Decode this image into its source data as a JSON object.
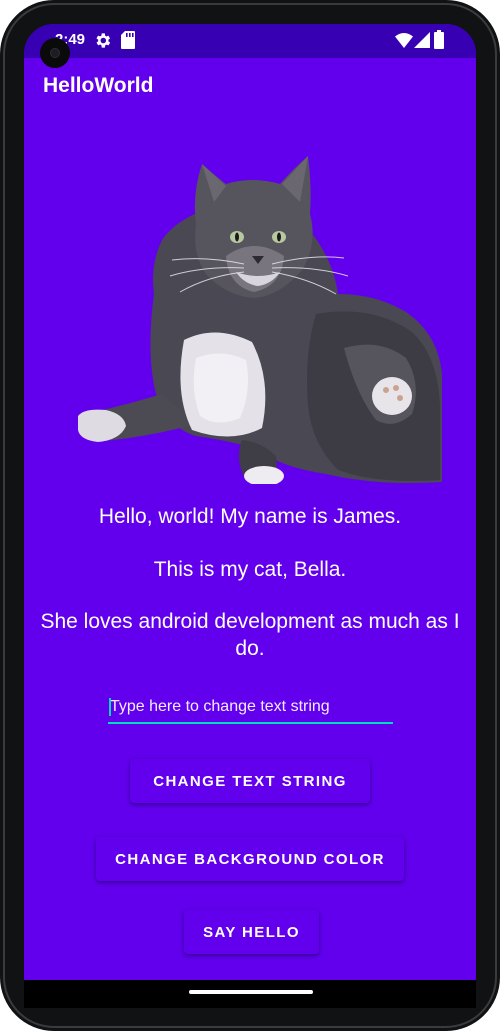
{
  "status_bar": {
    "time": "2:49",
    "icons": [
      "settings-gear-icon",
      "sd-card-icon",
      "wifi-icon",
      "cellular-signal-icon",
      "battery-icon"
    ],
    "background": "#3700b3"
  },
  "app_bar": {
    "title": "HelloWorld"
  },
  "content": {
    "image_subject": "cat-photo",
    "greeting": "Hello, world! My name is James.",
    "cat_line": "This is my cat, Bella.",
    "android_line": "She loves android development as much as I do."
  },
  "text_field": {
    "placeholder": "Type here to change text string",
    "value": ""
  },
  "buttons": {
    "change_text": "CHANGE TEXT STRING",
    "change_background": "CHANGE BACKGROUND COLOR",
    "say_hello": "SAY HELLO"
  },
  "colors": {
    "background": "#6200ee",
    "accent": "#03dac5",
    "status_bar": "#3700b3"
  }
}
